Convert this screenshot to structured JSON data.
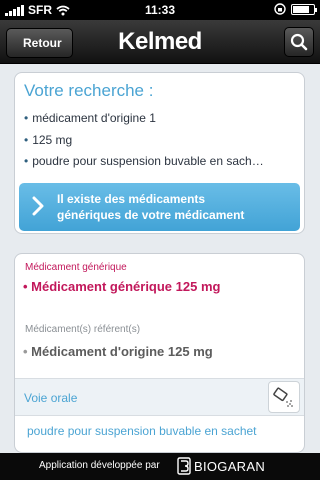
{
  "status_bar": {
    "carrier": "SFR",
    "time": "11:33",
    "battery_level": 0.8
  },
  "nav": {
    "back_label": "Retour",
    "logo_text": "Kelmed",
    "search_icon": "search-icon"
  },
  "search_card": {
    "title": "Votre recherche :",
    "criteria": [
      "médicament d'origine 1",
      "125 mg",
      "poudre pour suspension buvable en sach…"
    ],
    "generic_button": {
      "line1": "Il existe des médicaments",
      "line2": "génériques de votre médicament"
    }
  },
  "detail_card": {
    "generic_label": "Médicament générique",
    "generic_value": "Médicament générique 125 mg",
    "reference_label": "Médicament(s) référent(s)",
    "reference_value": "Médicament d'origine 125 mg",
    "route_label": "Voie orale",
    "route_icon": "oral-sachet-icon",
    "form_value": "poudre pour suspension buvable en sachet"
  },
  "footer": {
    "text": "Application développée par",
    "brand": "BIOGARAN"
  },
  "colors": {
    "accent": "#4ba4d3",
    "generic": "#c2185b",
    "reference": "#5c5c5c",
    "button": "#42a3d6"
  }
}
